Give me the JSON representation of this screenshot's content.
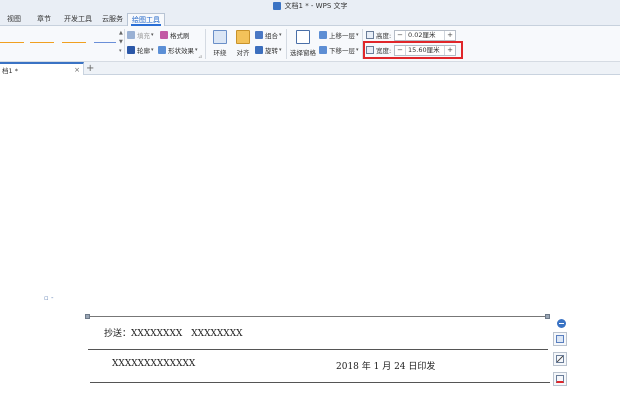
{
  "window": {
    "title": "文档1 * - WPS 文字"
  },
  "menu_tabs": [
    {
      "label": "视图"
    },
    {
      "label": "章节"
    },
    {
      "label": "开发工具"
    },
    {
      "label": "云服务"
    },
    {
      "label": "绘图工具",
      "active": true
    }
  ],
  "ribbon": {
    "fill_label": "填充",
    "format_painter_label": "格式刷",
    "outline_label": "轮廓",
    "shape_effect_label": "形状效果",
    "wrap_label": "环绕",
    "align_label": "对齐",
    "rotate_label": "旋转",
    "group_label": "组合",
    "selection_pane_label": "选择窗格",
    "bring_forward_label": "上移一层",
    "send_backward_label": "下移一层",
    "height": {
      "label": "高度:",
      "value": "0.02厘米",
      "minus": "−",
      "plus": "+"
    },
    "width": {
      "label": "宽度:",
      "value": "15.60厘米",
      "minus": "−",
      "plus": "+"
    },
    "line_style_colors": [
      "#f0a020",
      "#f0a020",
      "#f0a020",
      "#6a8fd8"
    ]
  },
  "doc_tab": {
    "name": "档1 *",
    "close": "×",
    "new_tab": "+"
  },
  "document": {
    "paragraph_mark": "▫ -",
    "cc_line": "抄送：XXXXXXXX　XXXXXXXX",
    "org_line": "XXXXXXXXXXXXX",
    "date_line": "2018 年 1 月 24 日印发"
  },
  "colors": {
    "accent": "#2a6fd6",
    "highlight_box": "#e0262a",
    "ribbon_bg": "#f7f9fc"
  }
}
